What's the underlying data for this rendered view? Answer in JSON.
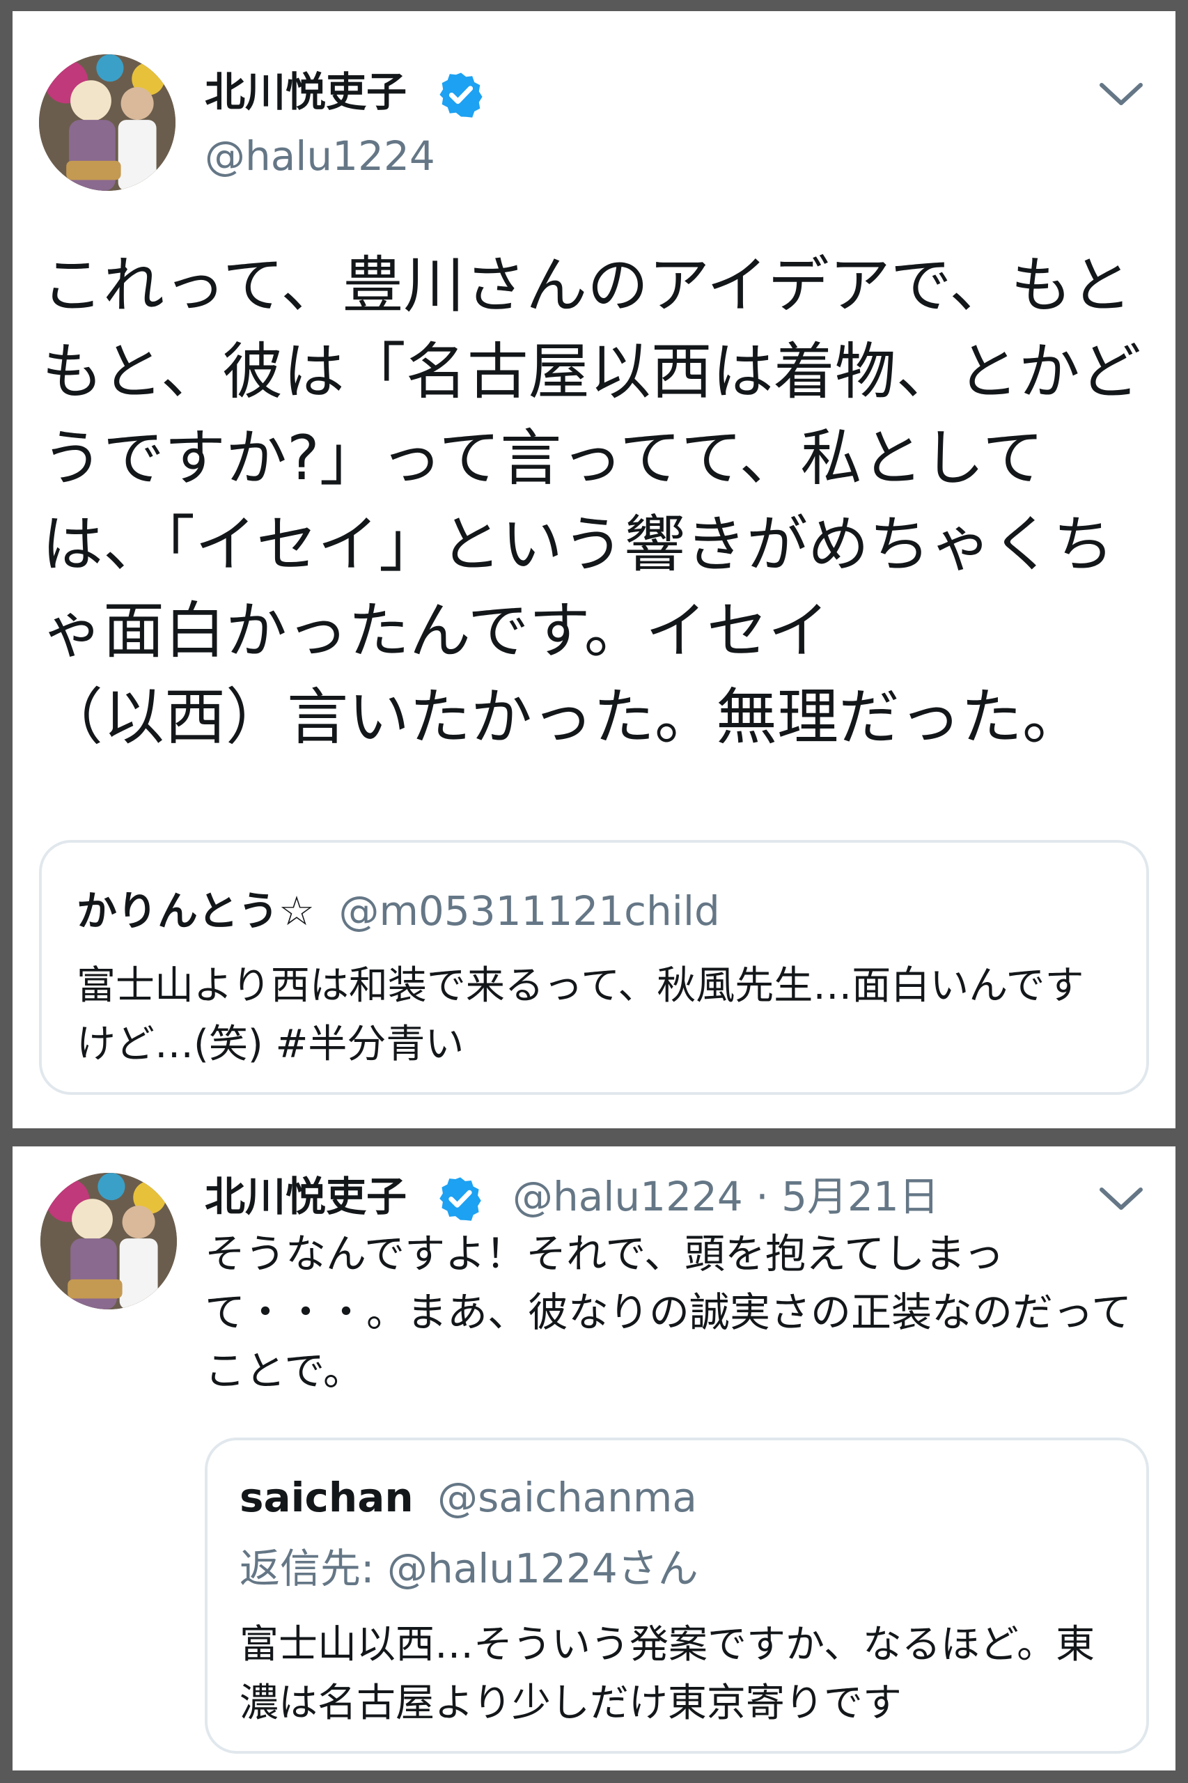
{
  "tweet1": {
    "author_name": "北川悦吏子",
    "handle": "@halu1224",
    "body": "これって、豊川さんのアイデアで、もともと、彼は「名古屋以西は着物、とかどうですか?」って言ってて、私としては、「イセイ」という響きがめちゃくちゃ面白かったんです。イセイ\n（以西）言いたかった。無理だった。",
    "quoted": {
      "name": "かりんとう☆",
      "handle": "@m05311121child",
      "text": "富士山より西は和装で来るって、秋風先生…面白いんですけど…(笑) #半分青い"
    }
  },
  "tweet2": {
    "author_name": "北川悦吏子",
    "handle": "@halu1224",
    "separator": "·",
    "date": "5月21日",
    "body": "そうなんですよ！それで、頭を抱えてしまって・・・。まあ、彼なりの誠実さの正装なのだってことで。",
    "quoted": {
      "name": "saichan",
      "handle": "@saichanma",
      "reply_to": "返信先: @halu1224さん",
      "text": "富士山以西…そういう発案ですか、なるほど。東濃は名古屋より少しだけ東京寄りです"
    }
  },
  "icons": {
    "verified": "verified-badge-icon",
    "menu": "chevron-down-icon"
  },
  "colors": {
    "verified_blue": "#1da1f2",
    "text": "#14171a",
    "secondary": "#657786",
    "border": "#e1e8ed",
    "frame": "#595959"
  }
}
